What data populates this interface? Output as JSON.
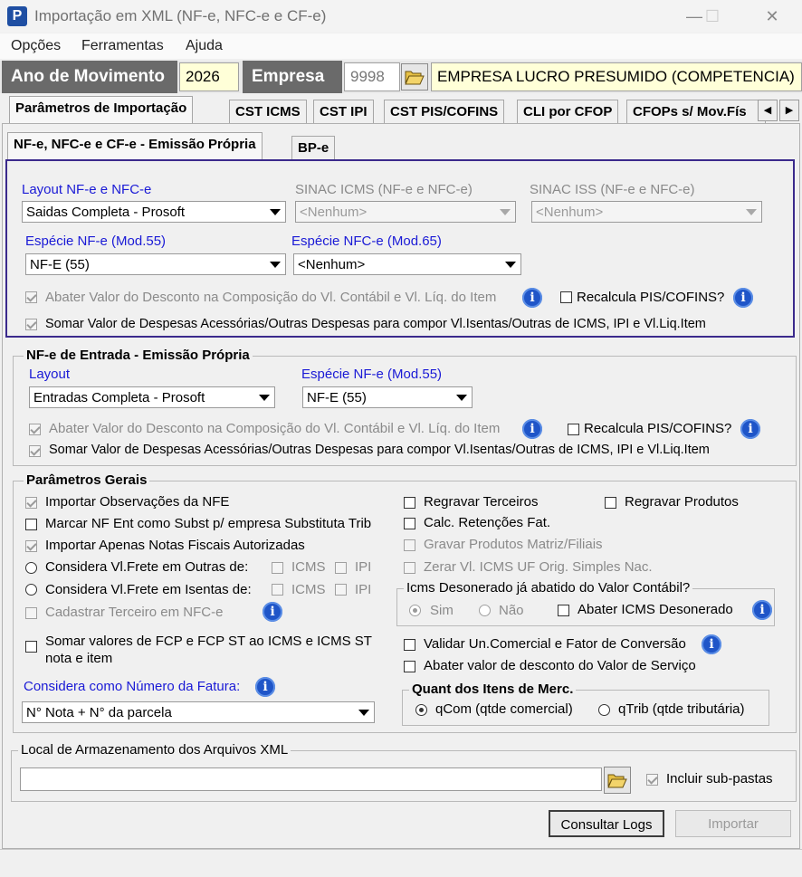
{
  "window": {
    "title": "Importação em XML (NF-e, NFC-e e CF-e)",
    "logo": "P",
    "minimize": "—",
    "maximize": "☐",
    "close": "✕"
  },
  "menu": [
    "Opções",
    "Ferramentas",
    "Ajuda"
  ],
  "header": {
    "year_label": "Ano de Movimento",
    "year_value": "2026",
    "company_label": "Empresa",
    "company_code": "9998",
    "company_name": "EMPRESA LUCRO PRESUMIDO (COMPETENCIA)"
  },
  "main_tabs": [
    "Parâmetros de Importação",
    "CST ICMS",
    "CST IPI",
    "CST PIS/COFINS",
    "CLI por CFOP",
    "CFOPs s/ Mov.Fís"
  ],
  "tab_scroll": {
    "left": "◀",
    "right": "▶"
  },
  "sub_tabs": [
    "NF-e, NFC-e e CF-e - Emissão Própria",
    "BP-e"
  ],
  "saidas": {
    "layout_label": "Layout NF-e e NFC-e",
    "layout_value": "Saidas Completa - Prosoft",
    "sinac_icms_label": "SINAC ICMS (NF-e e NFC-e)",
    "sinac_icms_value": "<Nenhum>",
    "sinac_iss_label": "SINAC ISS (NF-e e NFC-e)",
    "sinac_iss_value": "<Nenhum>",
    "especie_nfe_label": "Espécie NF-e (Mod.55)",
    "especie_nfe_value": "NF-E (55)",
    "especie_nfce_label": "Espécie NFC-e (Mod.65)",
    "especie_nfce_value": "<Nenhum>",
    "abater_desconto": "Abater Valor do Desconto na Composição do Vl. Contábil e Vl. Líq. do Item",
    "recalcula": "Recalcula PIS/COFINS?",
    "somar_despesas": "Somar Valor de Despesas Acessórias/Outras Despesas para compor Vl.Isentas/Outras de ICMS, IPI e Vl.Liq.Item"
  },
  "entrada": {
    "title": "NF-e de Entrada - Emissão Própria",
    "layout_label": "Layout",
    "layout_value": "Entradas Completa - Prosoft",
    "especie_label": "Espécie NF-e (Mod.55)",
    "especie_value": "NF-E (55)",
    "abater_desconto": "Abater Valor do Desconto na Composição do Vl. Contábil e Vl. Líq. do Item",
    "recalcula": "Recalcula PIS/COFINS?",
    "somar_despesas": "Somar Valor de Despesas Acessórias/Outras Despesas para compor Vl.Isentas/Outras de ICMS, IPI e Vl.Liq.Item"
  },
  "gerais": {
    "title": "Parâmetros Gerais",
    "importar_obs": "Importar Observações da NFE",
    "marcar_nf": "Marcar NF Ent como Subst p/ empresa Substituta Trib",
    "importar_autorizadas": "Importar Apenas Notas Fiscais Autorizadas",
    "frete_outras": "Considera Vl.Frete em Outras de:",
    "frete_isentas": "Considera Vl.Frete em Isentas de:",
    "icms": "ICMS",
    "ipi": "IPI",
    "cadastrar_terceiro": "Cadastrar Terceiro em NFC-e",
    "somar_fcp_1": "Somar valores de FCP e FCP ST ao ICMS e ICMS ST",
    "somar_fcp_2": "nota e item",
    "numero_fatura_label": "Considera como Número da Fatura:",
    "numero_fatura_value": "N° Nota + N° da parcela",
    "regravar_terceiros": "Regravar Terceiros",
    "regravar_produtos": "Regravar Produtos",
    "calc_retencoes": "Calc. Retenções Fat.",
    "gravar_produtos": "Gravar Produtos Matriz/Filiais",
    "zerar_icms": "Zerar Vl. ICMS UF Orig. Simples Nac.",
    "icms_desonerado_title": "Icms Desonerado já abatido do Valor Contábil?",
    "sim": "Sim",
    "nao": "Não",
    "abater_icms_desonerado": "Abater ICMS Desonerado",
    "validar_un": "Validar Un.Comercial e Fator de Conversão",
    "abater_desconto_servico": "Abater valor de desconto do Valor de Serviço",
    "quant_title": "Quant dos Itens de Merc.",
    "qcom": "qCom (qtde comercial)",
    "qtrib": "qTrib (qtde tributária)"
  },
  "local": {
    "title": "Local de Armazenamento dos Arquivos XML",
    "path_value": "",
    "incluir_subpastas": "Incluir sub-pastas"
  },
  "buttons": {
    "consultar_logs": "Consultar Logs",
    "importar": "Importar"
  },
  "colors": {
    "border_highlight": "#3b2a8c",
    "label_blue": "#1a1ad6",
    "header_dark": "#6a6a6a",
    "yellow_field": "#ffffd8",
    "info_icon": "#1f55c8"
  }
}
